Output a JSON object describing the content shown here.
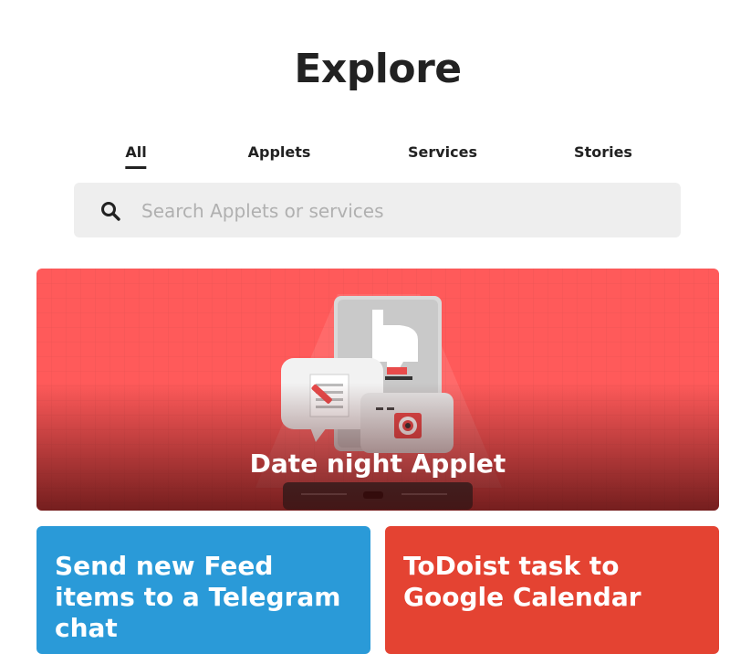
{
  "page": {
    "title": "Explore"
  },
  "tabs": [
    {
      "label": "All",
      "active": true
    },
    {
      "label": "Applets"
    },
    {
      "label": "Services"
    },
    {
      "label": "Stories"
    }
  ],
  "search": {
    "placeholder": "Search Applets or services",
    "value": "",
    "icon": "search-icon"
  },
  "hero": {
    "title": "Date night Applet",
    "color": "#ff5a5a"
  },
  "cards": [
    {
      "title": "Send new Feed items to a Telegram chat",
      "color": "#2a9ad8"
    },
    {
      "title": "ToDoist task to Google Calendar",
      "color": "#e44332"
    }
  ]
}
